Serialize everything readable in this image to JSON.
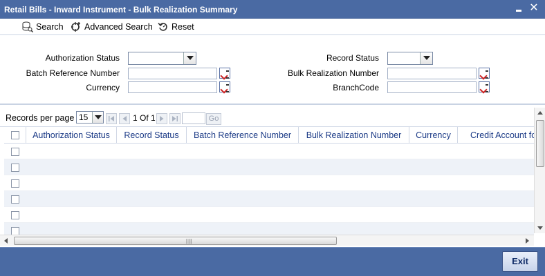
{
  "window": {
    "title": "Retail Bills - Inward Instrument - Bulk Realization Summary"
  },
  "toolbar": {
    "search_label": "Search",
    "advanced_search_label": "Advanced Search",
    "reset_label": "Reset"
  },
  "form": {
    "authorization_status_label": "Authorization Status",
    "record_status_label": "Record Status",
    "batch_reference_number_label": "Batch Reference Number",
    "bulk_realization_number_label": "Bulk Realization Number",
    "currency_label": "Currency",
    "branch_code_label": "BranchCode",
    "authorization_status_value": "",
    "record_status_value": "",
    "batch_reference_number_value": "",
    "bulk_realization_number_value": "",
    "currency_value": "",
    "branch_code_value": ""
  },
  "pager": {
    "records_per_page_label": "Records per page",
    "records_per_page_value": "15",
    "page_info": "1 Of 1",
    "go_label": "Go"
  },
  "grid": {
    "columns": [
      "Authorization Status",
      "Record Status",
      "Batch Reference Number",
      "Bulk Realization Number",
      "Currency",
      "Credit Account fo"
    ]
  },
  "footer": {
    "exit_label": "Exit"
  },
  "colors": {
    "titlebar": "#4a6aa3",
    "header_text": "#1b3a86",
    "row_alt": "#eef2f8"
  }
}
